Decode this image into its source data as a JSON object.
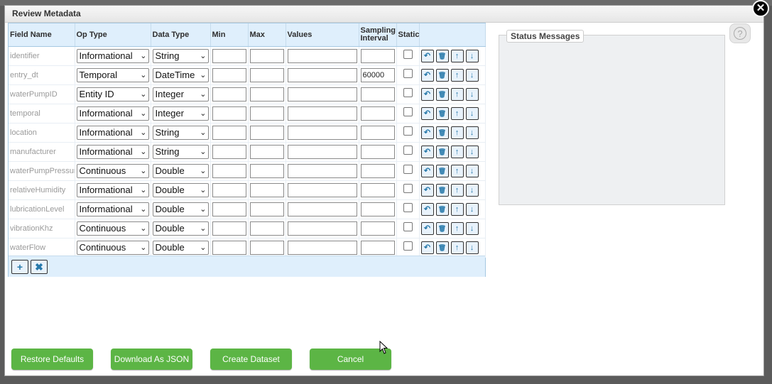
{
  "dialog": {
    "title": "Review Metadata"
  },
  "columns": [
    "Field Name",
    "Op Type",
    "Data Type",
    "Min",
    "Max",
    "Values",
    "Sampling Interval",
    "Static"
  ],
  "rows": [
    {
      "field": "identifier",
      "op": "Informational",
      "dtype": "String",
      "min": "",
      "max": "",
      "values": "",
      "interval": ""
    },
    {
      "field": "entry_dt",
      "op": "Temporal",
      "dtype": "DateTime",
      "min": "",
      "max": "",
      "values": "",
      "interval": "60000"
    },
    {
      "field": "waterPumpID",
      "op": "Entity ID",
      "dtype": "Integer",
      "min": "",
      "max": "",
      "values": "",
      "interval": ""
    },
    {
      "field": "temporal",
      "op": "Informational",
      "dtype": "Integer",
      "min": "",
      "max": "",
      "values": "",
      "interval": ""
    },
    {
      "field": "location",
      "op": "Informational",
      "dtype": "String",
      "min": "",
      "max": "",
      "values": "",
      "interval": ""
    },
    {
      "field": "manufacturer",
      "op": "Informational",
      "dtype": "String",
      "min": "",
      "max": "",
      "values": "",
      "interval": ""
    },
    {
      "field": "waterPumpPressur",
      "op": "Continuous",
      "dtype": "Double",
      "min": "",
      "max": "",
      "values": "",
      "interval": ""
    },
    {
      "field": "relativeHumidity",
      "op": "Informational",
      "dtype": "Double",
      "min": "",
      "max": "",
      "values": "",
      "interval": ""
    },
    {
      "field": "lubricationLevel",
      "op": "Informational",
      "dtype": "Double",
      "min": "",
      "max": "",
      "values": "",
      "interval": ""
    },
    {
      "field": "vibrationKhz",
      "op": "Continuous",
      "dtype": "Double",
      "min": "",
      "max": "",
      "values": "",
      "interval": ""
    },
    {
      "field": "waterFlow",
      "op": "Continuous",
      "dtype": "Double",
      "min": "",
      "max": "",
      "values": "",
      "interval": ""
    }
  ],
  "row_actions": [
    "undo-icon",
    "trash-icon",
    "arrow-up-icon",
    "arrow-down-icon"
  ],
  "footer_actions": [
    "plus-icon",
    "x-icon"
  ],
  "status": {
    "legend": "Status Messages"
  },
  "buttons": {
    "restore": "Restore Defaults",
    "download": "Download As JSON",
    "create": "Create Dataset",
    "cancel": "Cancel"
  },
  "colors": {
    "button_green": "#5cb545",
    "header_blue": "#dfeffc"
  }
}
